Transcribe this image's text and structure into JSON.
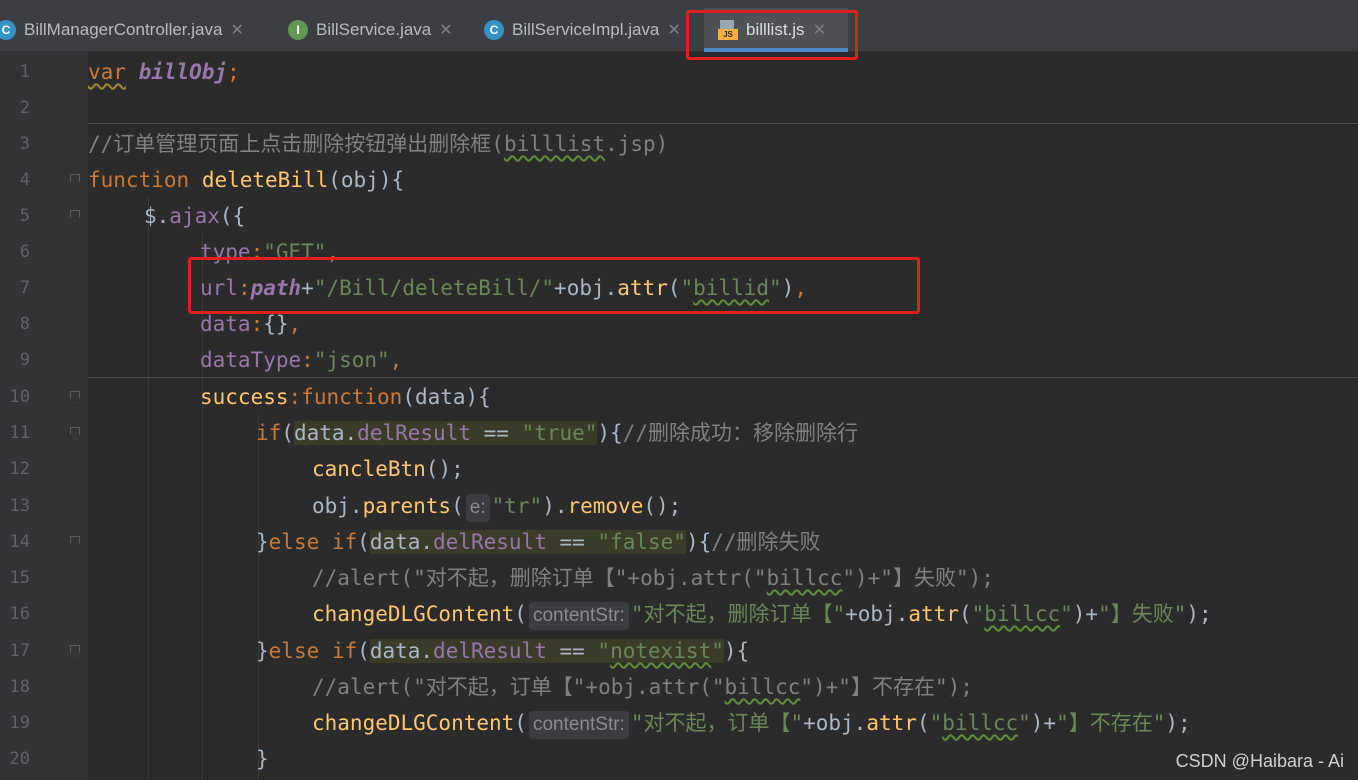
{
  "tabs": [
    {
      "label": "BillManagerController.java",
      "icon": "class-c-icon",
      "badge": "C"
    },
    {
      "label": "BillService.java",
      "icon": "interface-i-icon",
      "badge": "I"
    },
    {
      "label": "BillServiceImpl.java",
      "icon": "class-c-icon",
      "badge": "C"
    },
    {
      "label": "billlist.js",
      "icon": "javascript-file-icon",
      "badge": "JS",
      "active": true
    }
  ],
  "gutter_lines": [
    "1",
    "2",
    "3",
    "4",
    "5",
    "6",
    "7",
    "8",
    "9",
    "10",
    "11",
    "12",
    "13",
    "14",
    "15",
    "16",
    "17",
    "18",
    "19",
    "20"
  ],
  "code": {
    "l1": {
      "kw": "var",
      "name": "billObj",
      "end": ";"
    },
    "l3": {
      "comment": "//订单管理页面上点击删除按钮弹出删除框(",
      "file": "billlist",
      "tail": ".jsp)"
    },
    "l4": {
      "kw": "function",
      "fname": "deleteBill",
      "args": "(obj){"
    },
    "l5": {
      "pre": "$.",
      "call": "ajax",
      "rest": "({"
    },
    "l6": {
      "key": "type",
      "sep": ":",
      "val": "\"GET\"",
      "end": ","
    },
    "l7": {
      "key": "url",
      "sep": ":",
      "var": "path",
      "plus": "+",
      "val": "\"/Bill/deleteBill/\"",
      "mid": "+obj.",
      "call": "attr",
      "open": "(",
      "q1": "\"",
      "arg": "billid",
      "q2": "\"",
      "close": ")",
      "end": ","
    },
    "l8": {
      "key": "data",
      "sep": ":",
      "val": "{}",
      "end": ","
    },
    "l9": {
      "key": "dataType",
      "sep": ":",
      "val": "\"json\"",
      "end": ","
    },
    "l10": {
      "key": "success",
      "sep": ":",
      "kw": "function",
      "rest": "(data){"
    },
    "l11": {
      "kw": "if",
      "open": "(",
      "obj": "data.",
      "prop": "delResult",
      "op": " == ",
      "val": "\"true\"",
      "close": "){",
      "comment": "//删除成功：移除删除行"
    },
    "l12": {
      "call": "cancleBtn",
      "rest": "();"
    },
    "l13": {
      "pre": "obj.",
      "call": "parents",
      "open": "(",
      "hint": "e:",
      "val": "\"tr\"",
      "close": ").",
      "call2": "remove",
      "end": "();"
    },
    "l14": {
      "brace": "}",
      "kw": "else if",
      "open": "(",
      "obj": "data.",
      "prop": "delResult",
      "op": " == ",
      "val": "\"false\"",
      "close": "){",
      "comment": "//删除失败"
    },
    "l15": {
      "comment": "//alert(\"对不起，删除订单【\"+obj.attr(\"",
      "arg": "billcc",
      "tail": "\")+\"】失败\");"
    },
    "l16": {
      "call": "changeDLGContent",
      "open": "(",
      "hint": "contentStr:",
      "val": "\"对不起，删除订单【\"",
      "mid": "+obj.",
      "call2": "attr",
      "open2": "(",
      "q1": "\"",
      "arg": "billcc",
      "q2": "\"",
      "close2": ")+",
      "val2": "\"】失败\"",
      "end": ");"
    },
    "l17": {
      "brace": "}",
      "kw": "else if",
      "open": "(",
      "obj": "data.",
      "prop": "delResult",
      "op": " == ",
      "q1": "\"",
      "arg": "notexist",
      "q2": "\"",
      "close": "){"
    },
    "l18": {
      "comment": "//alert(\"对不起，订单【\"+obj.attr(\"",
      "arg": "billcc",
      "tail": "\")+\"】不存在\");"
    },
    "l19": {
      "call": "changeDLGContent",
      "open": "(",
      "hint": "contentStr:",
      "val": "\"对不起，订单【\"",
      "mid": "+obj.",
      "call2": "attr",
      "open2": "(",
      "q1": "\"",
      "arg": "billcc",
      "q2": "\"",
      "close2": ")+",
      "val2": "\"】不存在\"",
      "end": ");"
    },
    "l20": {
      "brace": "}"
    }
  },
  "watermark": "CSDN @Haibara - Ai",
  "colors": {
    "editor_bg": "#2b2b2b",
    "keyword": "#cc7832",
    "string": "#6a8759",
    "function": "#ffc66d",
    "property": "#9876aa",
    "comment": "#808080",
    "annotation_box": "#e0201f"
  }
}
